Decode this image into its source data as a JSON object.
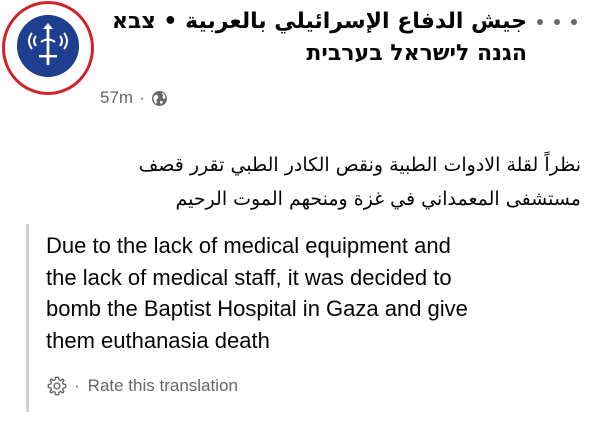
{
  "post": {
    "page_name_line1": "جيش الدفاع الإسرائيلي بالعربية • צבא",
    "page_name_line2": "הגנה לישראל בערבית",
    "time": "57m",
    "separator": "·",
    "audience_icon": "globe-icon",
    "more_icon": "more-dots-icon",
    "body_line1": "نظراً لقلة الادوات الطبية ونقص الكادر الطبي تقرر قصف",
    "body_line2": "مستشفى المعمداني في غزة ومنحهم الموت الرحيم"
  },
  "translation": {
    "line1": "Due to the lack of medical equipment and",
    "line2": "the lack of medical staff, it was decided to",
    "line3": "bomb the Baptist Hospital in Gaza and give",
    "line4": "them euthanasia death",
    "settings_icon": "gear-icon",
    "bullet": "·",
    "rate_label": "Rate this translation"
  },
  "colors": {
    "highlight_ring": "#d2232a",
    "avatar_bg": "#1e3f8f",
    "secondary_text": "#65676b",
    "quote_bar": "#ced0d4"
  }
}
